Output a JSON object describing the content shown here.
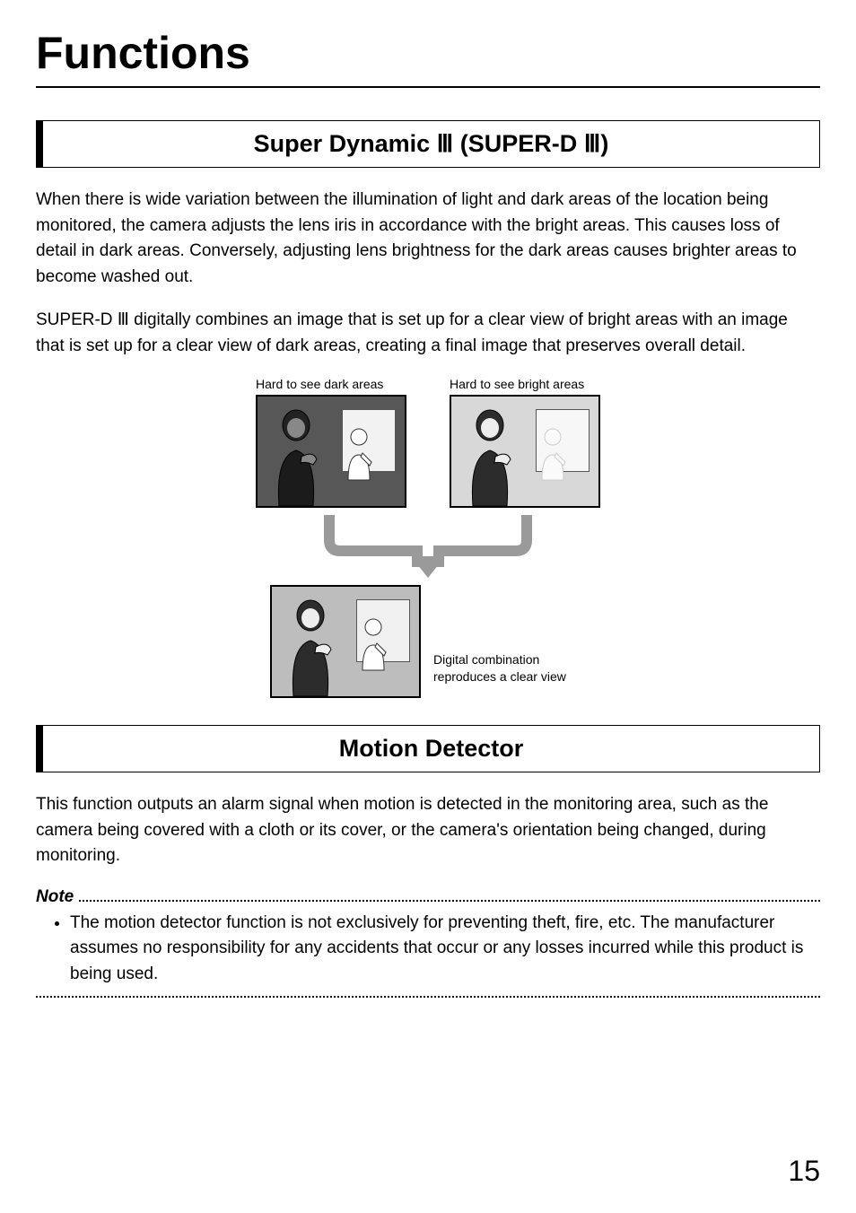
{
  "page": {
    "title": "Functions",
    "number": "15"
  },
  "sections": [
    {
      "title": "Super Dynamic Ⅲ (SUPER-D Ⅲ)",
      "paragraphs": [
        "When there is wide variation between the illumination of light and dark areas of the location being monitored, the camera adjusts the lens iris in accordance with the bright areas. This causes loss of detail in dark areas. Conversely, adjusting lens brightness for the dark areas causes brighter areas to become washed out.",
        "SUPER-D Ⅲ digitally combines an image that is set up for a clear view of bright areas with an image that is set up for a clear view of dark areas, creating a final image that preserves overall detail."
      ],
      "diagram": {
        "left_caption": "Hard to see dark areas",
        "right_caption": "Hard to see bright areas",
        "result_caption": "Digital combination reproduces a clear view"
      }
    },
    {
      "title": "Motion Detector",
      "paragraphs": [
        "This function outputs an alarm signal when motion is detected in the monitoring area, such as the camera being covered with a cloth or its cover, or the camera's orientation being changed, during monitoring."
      ],
      "note": {
        "label": "Note",
        "items": [
          "The motion detector function is not exclusively for preventing theft, fire, etc. The manufacturer assumes no responsibility for any accidents that occur or any losses incurred while this product is being used."
        ]
      }
    }
  ]
}
